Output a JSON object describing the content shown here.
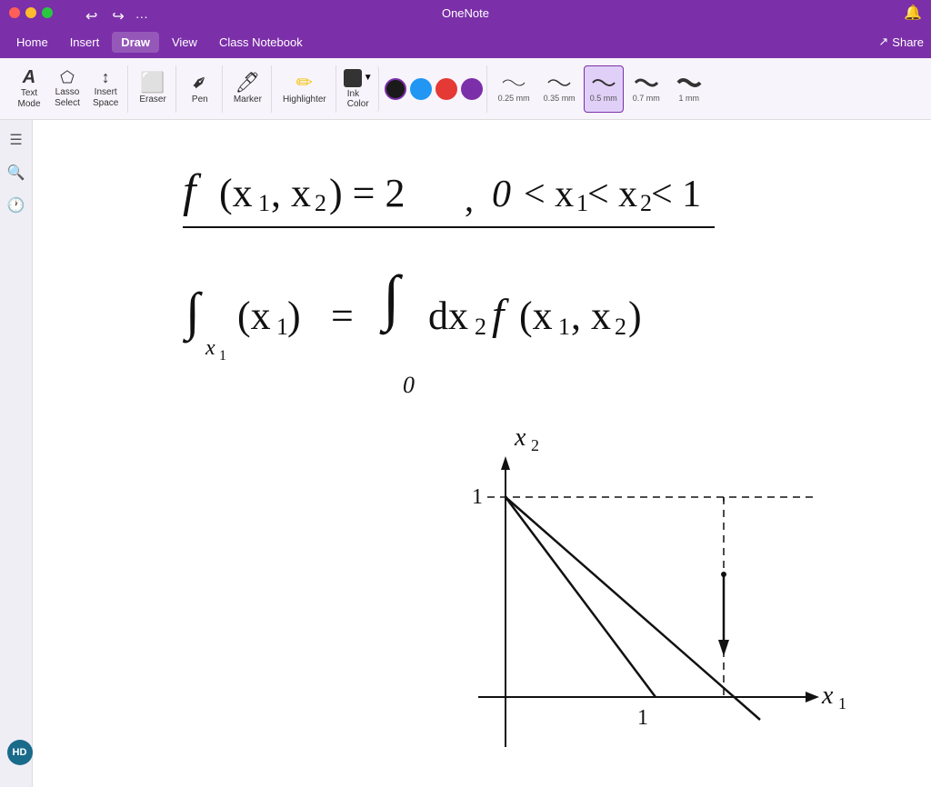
{
  "titlebar": {
    "title": "OneNote",
    "undo_label": "↩",
    "redo_label": "↪",
    "more_label": "···"
  },
  "menu": {
    "items": [
      "Home",
      "Insert",
      "Draw",
      "View",
      "Class Notebook"
    ],
    "active": "Draw",
    "share_label": "Share",
    "bell_label": "🔔"
  },
  "toolbar": {
    "tools": [
      {
        "id": "text-mode",
        "icon": "A",
        "label": "Text\nMode"
      },
      {
        "id": "lasso-select",
        "icon": "⬠",
        "label": "Lasso\nSelect"
      },
      {
        "id": "insert-space",
        "icon": "↕",
        "label": "Insert\nSpace"
      }
    ],
    "eraser": {
      "label": "Eraser"
    },
    "pen": {
      "label": "Pen"
    },
    "marker": {
      "label": "Marker"
    },
    "highlighter": {
      "label": "Highlighter"
    },
    "ink_color_label": "Ink\nColor",
    "colors": [
      {
        "color": "#1a1a1a",
        "selected": true
      },
      {
        "color": "#2196F3",
        "selected": false
      },
      {
        "color": "#e53935",
        "selected": false
      },
      {
        "color": "#7b2fa8",
        "selected": false
      }
    ],
    "thicknesses": [
      {
        "value": "0.25 mm",
        "height": 1,
        "selected": false
      },
      {
        "value": "0.35 mm",
        "height": 1.5,
        "selected": false
      },
      {
        "value": "0.5 mm",
        "height": 2,
        "selected": true
      },
      {
        "value": "0.7 mm",
        "height": 3,
        "selected": false
      },
      {
        "value": "1 mm",
        "height": 4,
        "selected": false
      }
    ]
  },
  "sidebar": {
    "items": [
      {
        "icon": "☰",
        "name": "notebooks"
      },
      {
        "icon": "🔍",
        "name": "search"
      },
      {
        "icon": "🕐",
        "name": "recent"
      }
    ]
  },
  "avatar": {
    "initials": "HD",
    "bg_color": "#1a6b8a"
  }
}
